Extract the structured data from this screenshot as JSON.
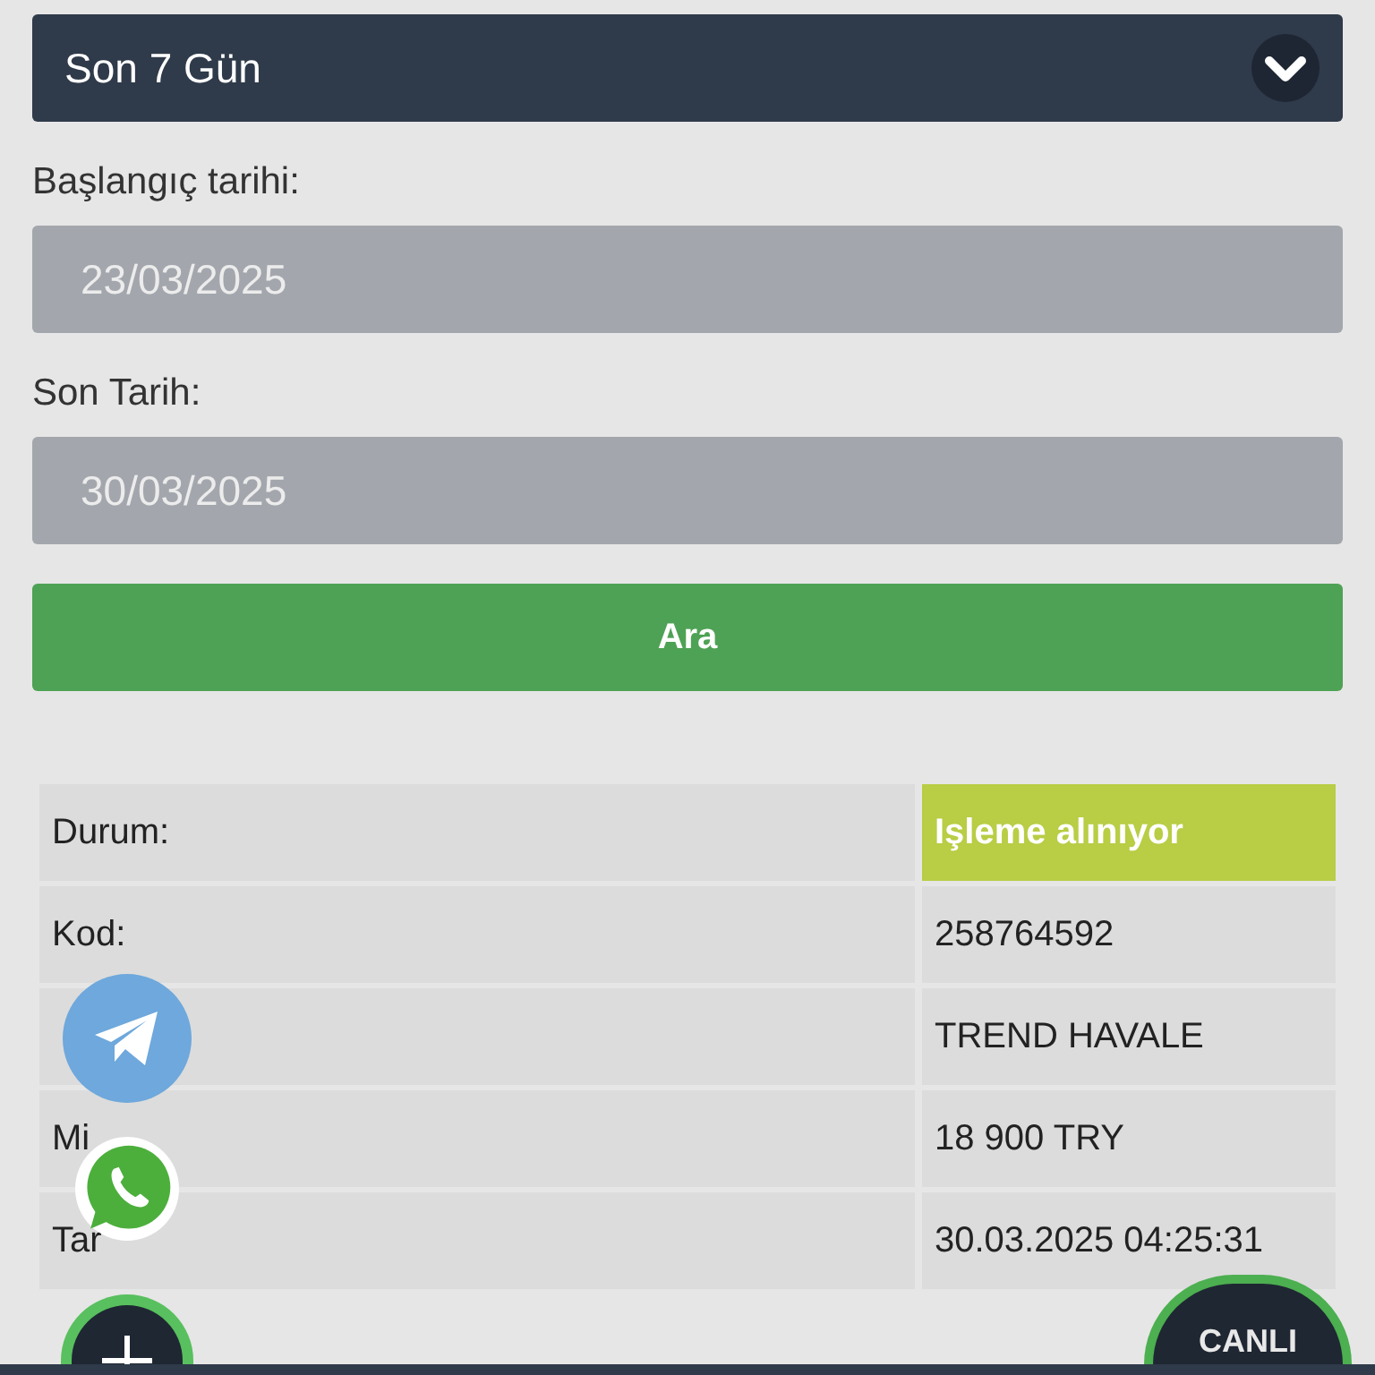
{
  "period_select": {
    "value": "Son 7 Gün"
  },
  "start_date": {
    "label": "Başlangıç tarihi:",
    "value": "23/03/2025"
  },
  "end_date": {
    "label": "Son Tarih:",
    "value": "30/03/2025"
  },
  "search_button": "Ara",
  "table": {
    "rows": [
      {
        "label": "Durum:",
        "value": "Işleme alınıyor",
        "kind": "status"
      },
      {
        "label": "Kod:",
        "value": "258764592",
        "kind": "plain"
      },
      {
        "value": "TREND HAVALE",
        "kind": "plain"
      },
      {
        "label": "Mi",
        "value": "18 900 TRY",
        "kind": "plain"
      },
      {
        "label": "Tar",
        "value": "30.03.2025 04:25:31",
        "kind": "plain"
      }
    ]
  },
  "live_support": {
    "label": "CANLI"
  }
}
